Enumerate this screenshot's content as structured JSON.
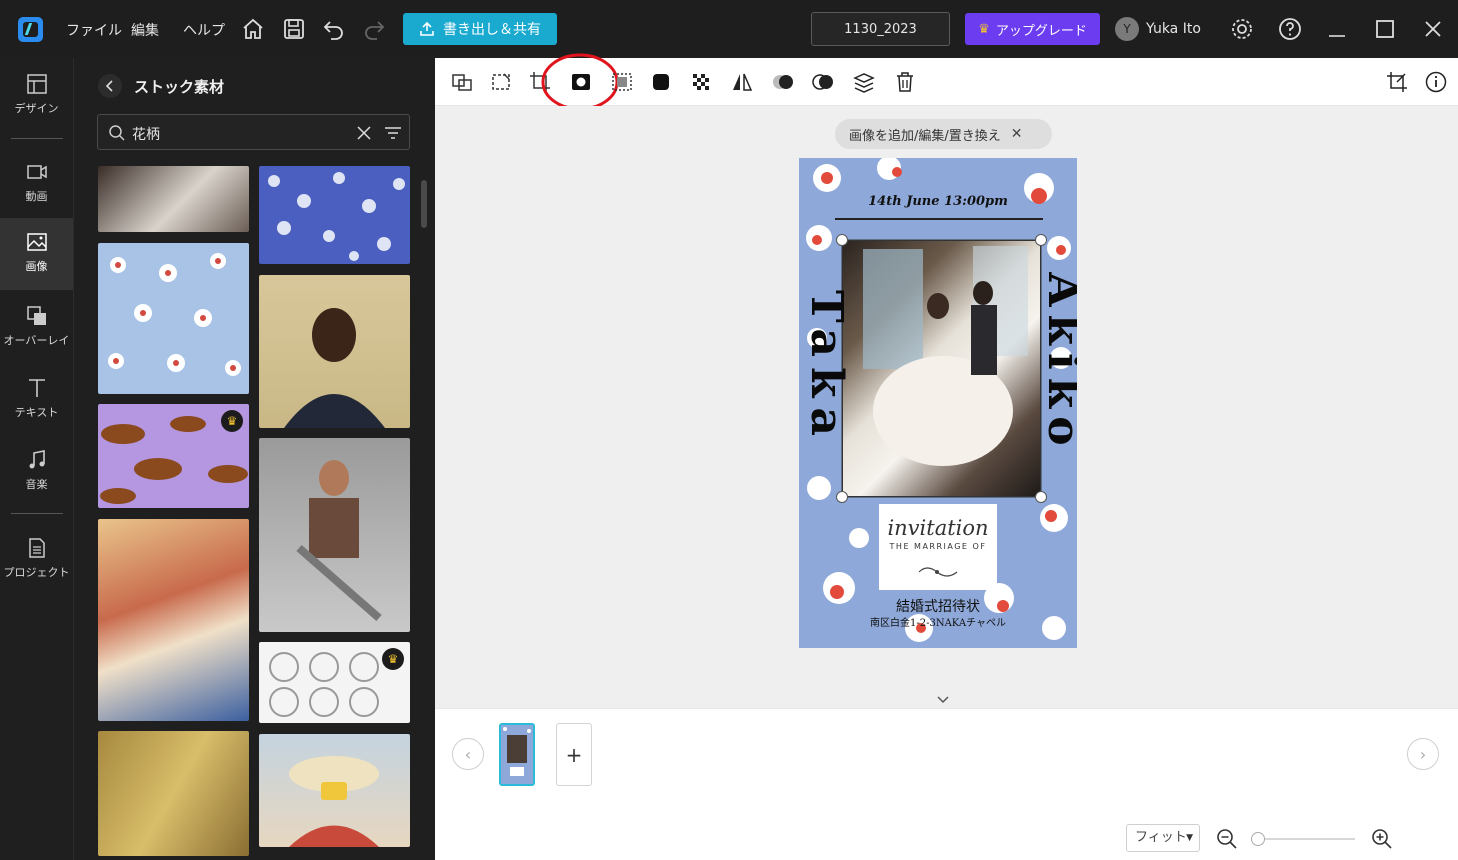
{
  "titlebar": {
    "menu": [
      "ファイル",
      "編集",
      "ヘルプ"
    ],
    "export_label": "書き出し＆共有",
    "doc_name": "1130_2023",
    "upgrade_label": "アップグレード",
    "avatar_initial": "Y",
    "user_name": "Yuka Ito"
  },
  "rail": {
    "items": [
      {
        "label": "デザイン",
        "icon": "design-icon"
      },
      {
        "label": "動画",
        "icon": "video-icon"
      },
      {
        "label": "画像",
        "icon": "image-icon"
      },
      {
        "label": "オーバーレイ",
        "icon": "overlay-icon"
      },
      {
        "label": "テキスト",
        "icon": "text-icon"
      },
      {
        "label": "音楽",
        "icon": "music-icon"
      },
      {
        "label": "プロジェクト",
        "icon": "project-icon"
      }
    ]
  },
  "panel": {
    "title": "ストック素材",
    "search_value": "花柄"
  },
  "stage": {
    "hint": "画像を追加/編集/置き換え"
  },
  "design": {
    "date_text": "14th June 13:00pm",
    "left_name": "Taka",
    "right_name": "Akiko",
    "invitation_script": "invitation",
    "marriage_text": "THE MARRIAGE OF",
    "title_ja": "結婚式招待状",
    "address": "南区白金1-2-3NAKAチャペル"
  },
  "bottom": {
    "fit_label": "フィット",
    "add_page": "+"
  },
  "colors": {
    "accent": "#1aa9cf",
    "upgrade": "#6c3cf0",
    "design_blue": "#8ea9d9",
    "flower_red": "#e24a3b"
  }
}
